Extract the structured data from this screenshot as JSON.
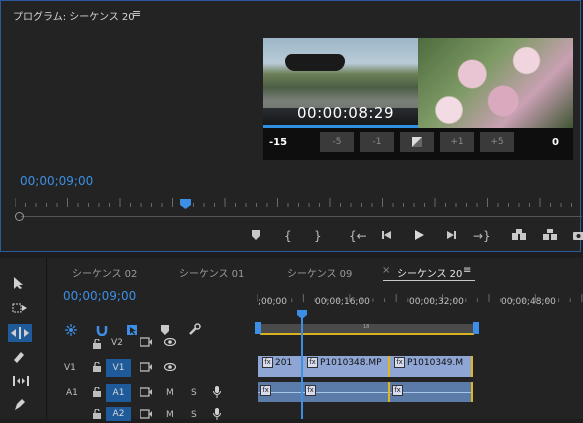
{
  "monitor": {
    "title": "プログラム: シーケンス 20",
    "menu_icon": "≡",
    "video_timecode": "00:00:08:29",
    "transition_controls": {
      "left_value": "-15",
      "right_value": "0",
      "buttons": [
        "-5",
        "-1",
        "+1",
        "+5"
      ]
    },
    "current_timecode": "00;00;09;00"
  },
  "timeline": {
    "tabs": [
      {
        "label": "シーケンス 02"
      },
      {
        "label": "シーケンス 01"
      },
      {
        "label": "シーケンス 09"
      },
      {
        "label": "シーケンス 20"
      }
    ],
    "tab_close": "×",
    "tab_menu": "≡",
    "current_timecode": "00;00;09;00",
    "ruler_labels": [
      ";00;00",
      "00;00;16;00",
      "00;00;32;00",
      "00;00;48;00"
    ],
    "tracks": [
      {
        "name": "V2",
        "target": "",
        "lock": "🔓"
      },
      {
        "name": "V1",
        "target": "V1",
        "lock": "🔓"
      },
      {
        "name": "A1",
        "target": "A1",
        "lock": "🔓",
        "m": "M",
        "s": "S"
      },
      {
        "name": "A2",
        "target": "A2",
        "lock": "🔓"
      }
    ],
    "clips_v1": [
      "201",
      "P1010348.MP",
      "P1010349.M"
    ],
    "fx_label": "fx",
    "workbar_label": "18"
  },
  "colors": {
    "accent_blue": "#3d8ee6",
    "clip_video": "#8fa6d4",
    "clip_audio": "#5b7ba8",
    "clip_edge": "#e0b51e"
  }
}
